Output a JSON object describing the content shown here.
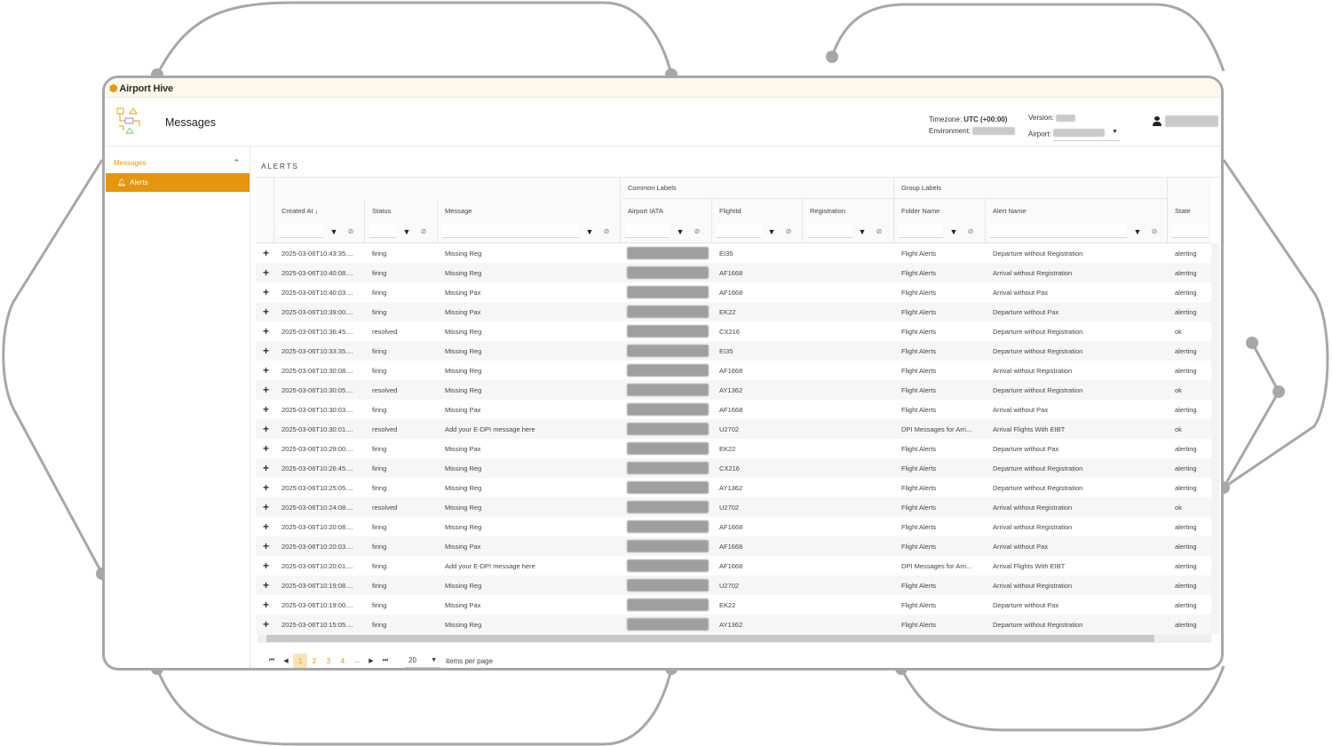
{
  "brand": {
    "name": "Airport Hive"
  },
  "header": {
    "title": "Messages",
    "timezone_label": "Timezone:",
    "timezone_value": "UTC (+00:00)",
    "environment_label": "Environment:",
    "version_label": "Version:",
    "airport_label": "Airport:"
  },
  "sidebar": {
    "group_label": "Messages",
    "item_label": "Alerts"
  },
  "section_title": "ALERTS",
  "grid": {
    "group_common": "Common Labels",
    "group_group": "Group Labels",
    "columns": {
      "created": "Created At ↓",
      "status": "Status",
      "message": "Message",
      "iata": "Airport IATA",
      "flight": "FlightId",
      "registration": "Registration",
      "folder": "Folder Name",
      "alert": "Alert Name",
      "state": "State"
    },
    "rows": [
      {
        "created": "2025-03-06T10:43:35....",
        "status": "firing",
        "message": "Missing Reg",
        "flight": "EI35",
        "folder": "Flight Alerts",
        "alert": "Departure without Registration",
        "state": "alerting"
      },
      {
        "created": "2025-03-06T10:40:08....",
        "status": "firing",
        "message": "Missing Reg",
        "flight": "AF1668",
        "folder": "Flight Alerts",
        "alert": "Arrival without Registration",
        "state": "alerting"
      },
      {
        "created": "2025-03-06T10:40:03....",
        "status": "firing",
        "message": "Missing Pax",
        "flight": "AF1668",
        "folder": "Flight Alerts",
        "alert": "Arrival without Pax",
        "state": "alerting"
      },
      {
        "created": "2025-03-06T10:39:00....",
        "status": "firing",
        "message": "Missing Pax",
        "flight": "EK22",
        "folder": "Flight Alerts",
        "alert": "Departure without Pax",
        "state": "alerting"
      },
      {
        "created": "2025-03-06T10:36:45....",
        "status": "resolved",
        "message": "Missing Reg",
        "flight": "CX216",
        "folder": "Flight Alerts",
        "alert": "Departure without Registration",
        "state": "ok"
      },
      {
        "created": "2025-03-06T10:33:35....",
        "status": "firing",
        "message": "Missing Reg",
        "flight": "EI35",
        "folder": "Flight Alerts",
        "alert": "Departure without Registration",
        "state": "alerting"
      },
      {
        "created": "2025-03-06T10:30:08....",
        "status": "firing",
        "message": "Missing Reg",
        "flight": "AF1668",
        "folder": "Flight Alerts",
        "alert": "Arrival without Registration",
        "state": "alerting"
      },
      {
        "created": "2025-03-06T10:30:05....",
        "status": "resolved",
        "message": "Missing Reg",
        "flight": "AY1362",
        "folder": "Flight Alerts",
        "alert": "Departure without Registration",
        "state": "ok"
      },
      {
        "created": "2025-03-06T10:30:03....",
        "status": "firing",
        "message": "Missing Pax",
        "flight": "AF1668",
        "folder": "Flight Alerts",
        "alert": "Arrival without Pax",
        "state": "alerting"
      },
      {
        "created": "2025-03-06T10:30:01....",
        "status": "resolved",
        "message": "Add your E-DPI message here",
        "flight": "U2702",
        "folder": "DPI Messages for Arri...",
        "alert": "Arrival Flights With EIBT",
        "state": "ok"
      },
      {
        "created": "2025-03-06T10:29:00....",
        "status": "firing",
        "message": "Missing Pax",
        "flight": "EK22",
        "folder": "Flight Alerts",
        "alert": "Departure without Pax",
        "state": "alerting"
      },
      {
        "created": "2025-03-06T10:26:45....",
        "status": "firing",
        "message": "Missing Reg",
        "flight": "CX216",
        "folder": "Flight Alerts",
        "alert": "Departure without Registration",
        "state": "alerting"
      },
      {
        "created": "2025-03-06T10:25:05....",
        "status": "firing",
        "message": "Missing Reg",
        "flight": "AY1362",
        "folder": "Flight Alerts",
        "alert": "Departure without Registration",
        "state": "alerting"
      },
      {
        "created": "2025-03-06T10:24:08....",
        "status": "resolved",
        "message": "Missing Reg",
        "flight": "U2702",
        "folder": "Flight Alerts",
        "alert": "Arrival without Registration",
        "state": "ok"
      },
      {
        "created": "2025-03-06T10:20:08....",
        "status": "firing",
        "message": "Missing Reg",
        "flight": "AF1668",
        "folder": "Flight Alerts",
        "alert": "Arrival without Registration",
        "state": "alerting"
      },
      {
        "created": "2025-03-06T10:20:03....",
        "status": "firing",
        "message": "Missing Pax",
        "flight": "AF1668",
        "folder": "Flight Alerts",
        "alert": "Arrival without Pax",
        "state": "alerting"
      },
      {
        "created": "2025-03-06T10:20:01....",
        "status": "firing",
        "message": "Add your E-DPI message here",
        "flight": "AF1668",
        "folder": "DPI Messages for Arri...",
        "alert": "Arrival Flights With EIBT",
        "state": "alerting"
      },
      {
        "created": "2025-03-06T10:19:08....",
        "status": "firing",
        "message": "Missing Reg",
        "flight": "U2702",
        "folder": "Flight Alerts",
        "alert": "Arrival without Registration",
        "state": "alerting"
      },
      {
        "created": "2025-03-06T10:19:00....",
        "status": "firing",
        "message": "Missing Pax",
        "flight": "EK22",
        "folder": "Flight Alerts",
        "alert": "Departure without Pax",
        "state": "alerting"
      },
      {
        "created": "2025-03-06T10:15:05....",
        "status": "firing",
        "message": "Missing Reg",
        "flight": "AY1362",
        "folder": "Flight Alerts",
        "alert": "Departure without Registration",
        "state": "alerting"
      }
    ]
  },
  "pager": {
    "pages": [
      "1",
      "2",
      "3",
      "4",
      "..."
    ],
    "current": "1",
    "page_size": "20",
    "items_per_page": "items per page"
  },
  "colors": {
    "accent": "#e39a14",
    "sidebar_active": "#e5950e",
    "frame": "#a7a7a7"
  },
  "icons": [
    "expand-row-icon",
    "filter-icon",
    "clear-filter-icon",
    "bell-icon",
    "user-icon",
    "caret-down-icon",
    "chevron-up-icon"
  ]
}
